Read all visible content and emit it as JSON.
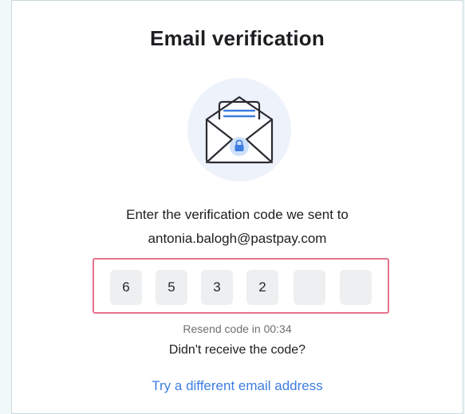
{
  "header": {
    "title": "Email verification"
  },
  "illustration": {
    "icon": "envelope-lock-icon",
    "circle_color": "#eef2fa",
    "accent_color": "#3d7ee0"
  },
  "instruction": {
    "line1": "Enter the verification code we sent to",
    "email": "antonia.balogh@pastpay.com"
  },
  "code": {
    "digits": [
      "6",
      "5",
      "3",
      "2",
      "",
      ""
    ],
    "highlight_color": "#e6738c"
  },
  "footer": {
    "resend_text": "Resend code in 00:34",
    "not_received_text": "Didn't receive the code?",
    "different_email_link": "Try a different email address",
    "link_color": "#3d7ee0"
  }
}
